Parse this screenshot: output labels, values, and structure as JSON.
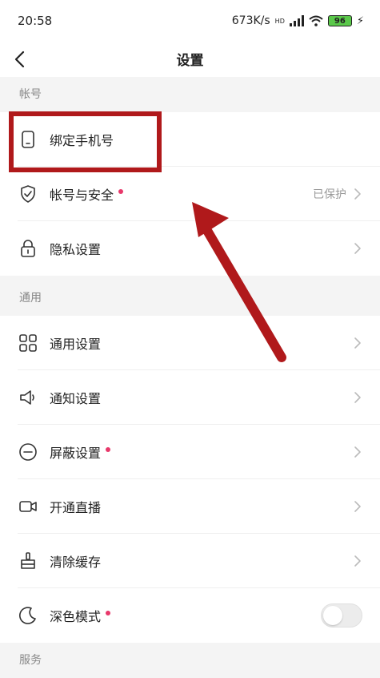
{
  "status_bar": {
    "time": "20:58",
    "net_speed": "673K/s",
    "signal_badge": "HD",
    "battery": "96"
  },
  "nav": {
    "title": "设置"
  },
  "sections": {
    "account": "帐号",
    "general": "通用",
    "services": "服务"
  },
  "rows": {
    "bind_phone": "绑定手机号",
    "account_security": "帐号与安全",
    "account_security_value": "已保护",
    "privacy": "隐私设置",
    "general_settings": "通用设置",
    "notification": "通知设置",
    "block": "屏蔽设置",
    "live": "开通直播",
    "clear_cache": "清除缓存",
    "dark_mode": "深色模式"
  },
  "dark_mode_enabled": false,
  "colors": {
    "annotation": "#b0191b",
    "red_dot": "#e8386a"
  }
}
